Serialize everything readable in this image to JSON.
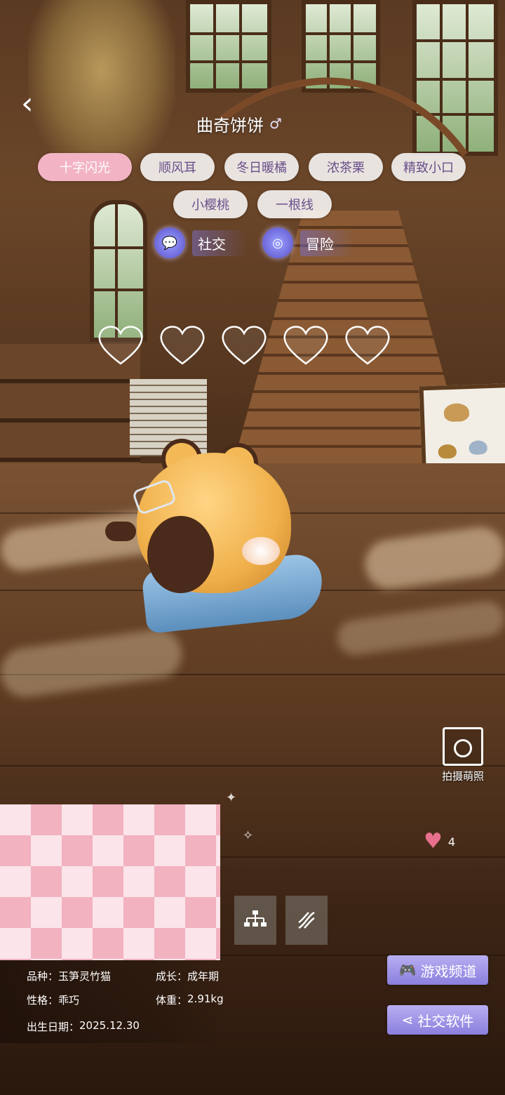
{
  "header": {
    "back_icon": "chevron-left-icon",
    "pet_name": "曲奇饼饼",
    "gender_symbol": "♂"
  },
  "tags": [
    {
      "label": "十字闪光",
      "active": true
    },
    {
      "label": "顺风耳",
      "active": false
    },
    {
      "label": "冬日暖橘",
      "active": false
    },
    {
      "label": "浓茶栗",
      "active": false
    },
    {
      "label": "精致小口",
      "active": false
    },
    {
      "label": "小樱桃",
      "active": false
    },
    {
      "label": "一根线",
      "active": false
    }
  ],
  "modes": {
    "social": {
      "label": "社交",
      "icon": "chat-bubble-icon"
    },
    "adventure": {
      "label": "冒险",
      "icon": "binoculars-icon"
    }
  },
  "hearts": {
    "filled": 0,
    "total": 5
  },
  "photo": {
    "label": "拍摄萌照",
    "icon": "camera-icon"
  },
  "likes": {
    "count": "4",
    "icon": "heart-icon"
  },
  "tools": [
    {
      "icon": "family-tree-icon"
    },
    {
      "icon": "dna-icon"
    }
  ],
  "info": {
    "breed_label": "品种：",
    "breed_value": "玉笋灵竹猫",
    "growth_label": "成长：",
    "growth_value": "成年期",
    "personality_label": "性格：",
    "personality_value": "乖巧",
    "weight_label": "体重：",
    "weight_value": "2.91kg",
    "birthday_label": "出生日期：",
    "birthday_value": "2025.12.30"
  },
  "actions": {
    "game_channel": "游戏频道",
    "social_app": "社交软件"
  },
  "colors": {
    "tag_active": "#f2b4c4",
    "action_button": "#a59cec",
    "like_heart": "#e8708c"
  }
}
